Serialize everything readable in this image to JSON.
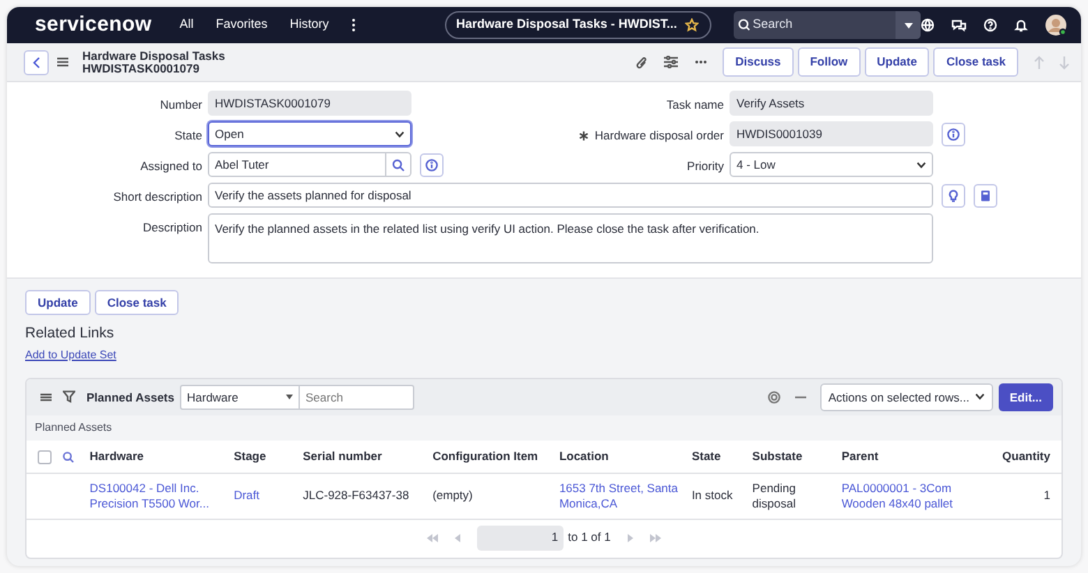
{
  "topbar": {
    "logo": "servicenow",
    "nav": [
      "All",
      "Favorites",
      "History"
    ],
    "context_title": "Hardware Disposal Tasks - HWDIST...",
    "search": {
      "placeholder": "Search"
    }
  },
  "form_header": {
    "title": "Hardware Disposal Tasks",
    "subtitle": "HWDISTASK0001079",
    "buttons": [
      "Discuss",
      "Follow",
      "Update",
      "Close task"
    ]
  },
  "form": {
    "rows": [
      {
        "fields": [
          {
            "label": "Number",
            "value": "HWDISTASK0001079",
            "kind": "readonly",
            "mandatory": false,
            "focused": false
          },
          {
            "label": "Task name",
            "value": "Verify Assets",
            "kind": "readonly",
            "mandatory": false,
            "focused": false
          }
        ]
      },
      {
        "fields": [
          {
            "label": "State",
            "value": "Open",
            "kind": "select",
            "mandatory": false,
            "focused": true
          },
          {
            "label": "Hardware disposal order",
            "value": "HWDIS0001039",
            "kind": "readonly_reference",
            "mandatory": true,
            "focused": false
          }
        ]
      },
      {
        "fields": [
          {
            "label": "Assigned to",
            "value": "Abel Tuter",
            "kind": "reference",
            "mandatory": false,
            "focused": false
          },
          {
            "label": "Priority",
            "value": "4 - Low",
            "kind": "select",
            "mandatory": false,
            "focused": false
          }
        ]
      },
      {
        "fields": [
          {
            "label": "Short description",
            "value": "Verify the assets planned for disposal",
            "kind": "suggest_text",
            "mandatory": false,
            "focused": false
          }
        ]
      },
      {
        "fields": [
          {
            "label": "Description",
            "value": "Verify the planned assets in the related list using verify UI action. Please close the task after verification.",
            "kind": "textarea",
            "mandatory": false,
            "focused": false
          }
        ]
      }
    ]
  },
  "form_buttons": [
    "Update",
    "Close task"
  ],
  "related_links": {
    "title": "Related Links",
    "links": [
      "Add to Update Set"
    ]
  },
  "related_list": {
    "title": "Planned Assets",
    "filter_field": "Hardware",
    "search": {
      "placeholder": "Search"
    },
    "actions": "Actions on selected rows...",
    "edit_button": "Edit...",
    "caption": "Planned Assets",
    "select_all": {
      "checked": false
    },
    "columns": [
      "Hardware",
      "Stage",
      "Serial number",
      "Configuration Item",
      "Location",
      "State",
      "Substate",
      "Parent",
      "Quantity"
    ],
    "rows": [
      {
        "cells": [
          {
            "text": "DS100042 - Dell Inc. Precision T5500 Wor...",
            "link": true
          },
          {
            "text": "Draft",
            "link": true
          },
          {
            "text": "JLC-928-F63437-38",
            "link": false
          },
          {
            "text": "(empty)",
            "link": false
          },
          {
            "text": "1653 7th Street, Santa Monica,CA",
            "link": true
          },
          {
            "text": "In stock",
            "link": false
          },
          {
            "text": "Pending disposal",
            "link": false
          },
          {
            "text": "PAL0000001 - 3Com Wooden 48x40 pallet",
            "link": true
          },
          {
            "text": "1",
            "link": false
          }
        ]
      }
    ],
    "pagination": {
      "page": "1",
      "range": "to 1 of 1"
    }
  }
}
